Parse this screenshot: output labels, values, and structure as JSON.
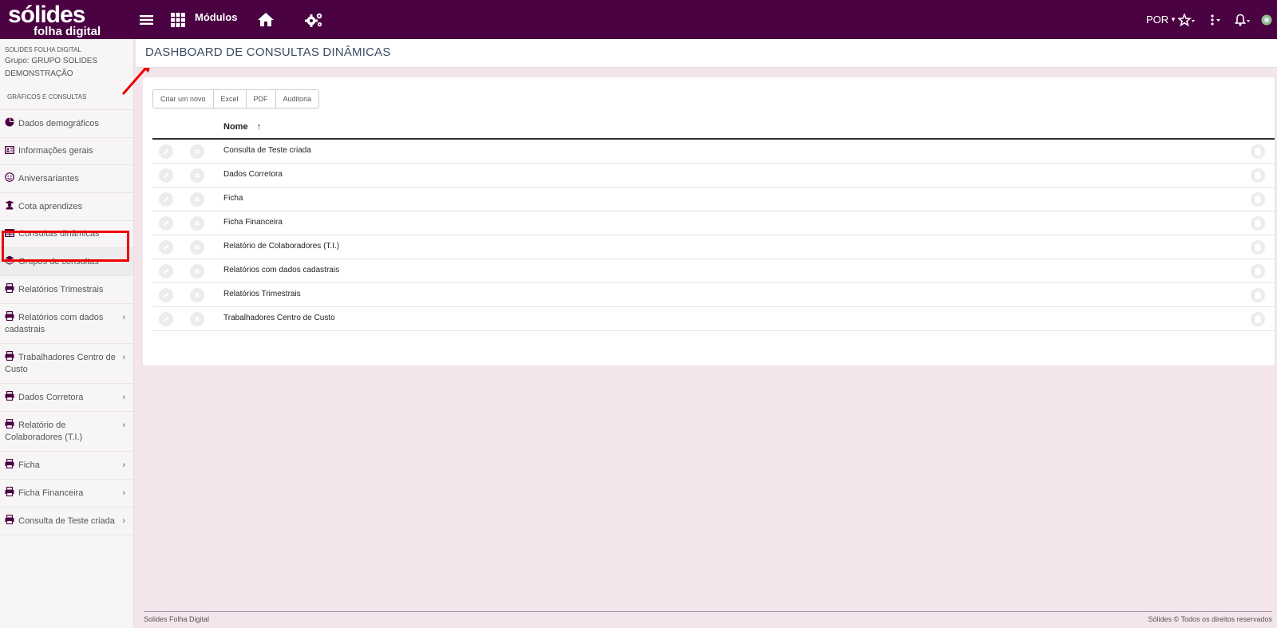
{
  "header": {
    "logo_main": "sólides",
    "logo_sub": "folha digital",
    "modules_label": "Módulos",
    "language": "POR"
  },
  "sidebar": {
    "company": "SOLIDES FOLHA DIGITAL",
    "group": "Grupo: GRUPO SOLIDES DEMONSTRAÇÃO",
    "section": "GRÁFICOS E CONSULTAS",
    "items": [
      {
        "label": "Dados demográficos",
        "icon": "pie-chart-icon"
      },
      {
        "label": "Informações gerais",
        "icon": "id-card-icon"
      },
      {
        "label": "Aniversariantes",
        "icon": "smile-icon"
      },
      {
        "label": "Cota aprendizes",
        "icon": "graduate-icon"
      },
      {
        "label": "Consultas dinâmicas",
        "icon": "table-icon"
      },
      {
        "label": "Grupos de consultas",
        "icon": "layers-icon"
      },
      {
        "label": "Relatórios Trimestrais",
        "icon": "printer-icon"
      },
      {
        "label": "Relatórios com dados cadastrais",
        "icon": "printer-icon"
      },
      {
        "label": "Trabalhadores Centro de Custo",
        "icon": "printer-icon"
      },
      {
        "label": "Dados Corretora",
        "icon": "printer-icon"
      },
      {
        "label": "Relatório de Colaboradores (T.I.)",
        "icon": "printer-icon"
      },
      {
        "label": "Ficha",
        "icon": "printer-icon"
      },
      {
        "label": "Ficha Financeira",
        "icon": "printer-icon"
      },
      {
        "label": "Consulta de Teste criada",
        "icon": "printer-icon"
      }
    ]
  },
  "page": {
    "title": "DASHBOARD DE CONSULTAS DINÂMICAS"
  },
  "toolbar": {
    "create_label": "Criar um novo",
    "excel_label": "Excel",
    "pdf_label": "PDF",
    "audit_label": "Auditoria"
  },
  "table": {
    "column_name": "Nome",
    "sort_indicator": "↑",
    "rows": [
      "Consulta de Teste criada",
      "Dados Corretora",
      "Ficha",
      "Ficha Financeira",
      "Relatório de Colaboradores (T.I.)",
      "Relatórios com dados cadastrais",
      "Relatórios Trimestrais",
      "Trabalhadores Centro de Custo"
    ]
  },
  "footer": {
    "left": "Solides Folha Digital",
    "right": "Sólides © Todos os direitos reservados"
  },
  "colors": {
    "topbar": "#4a0242",
    "background": "#f4e4ec",
    "highlight": "#e00000",
    "icon": "#4a0242"
  }
}
